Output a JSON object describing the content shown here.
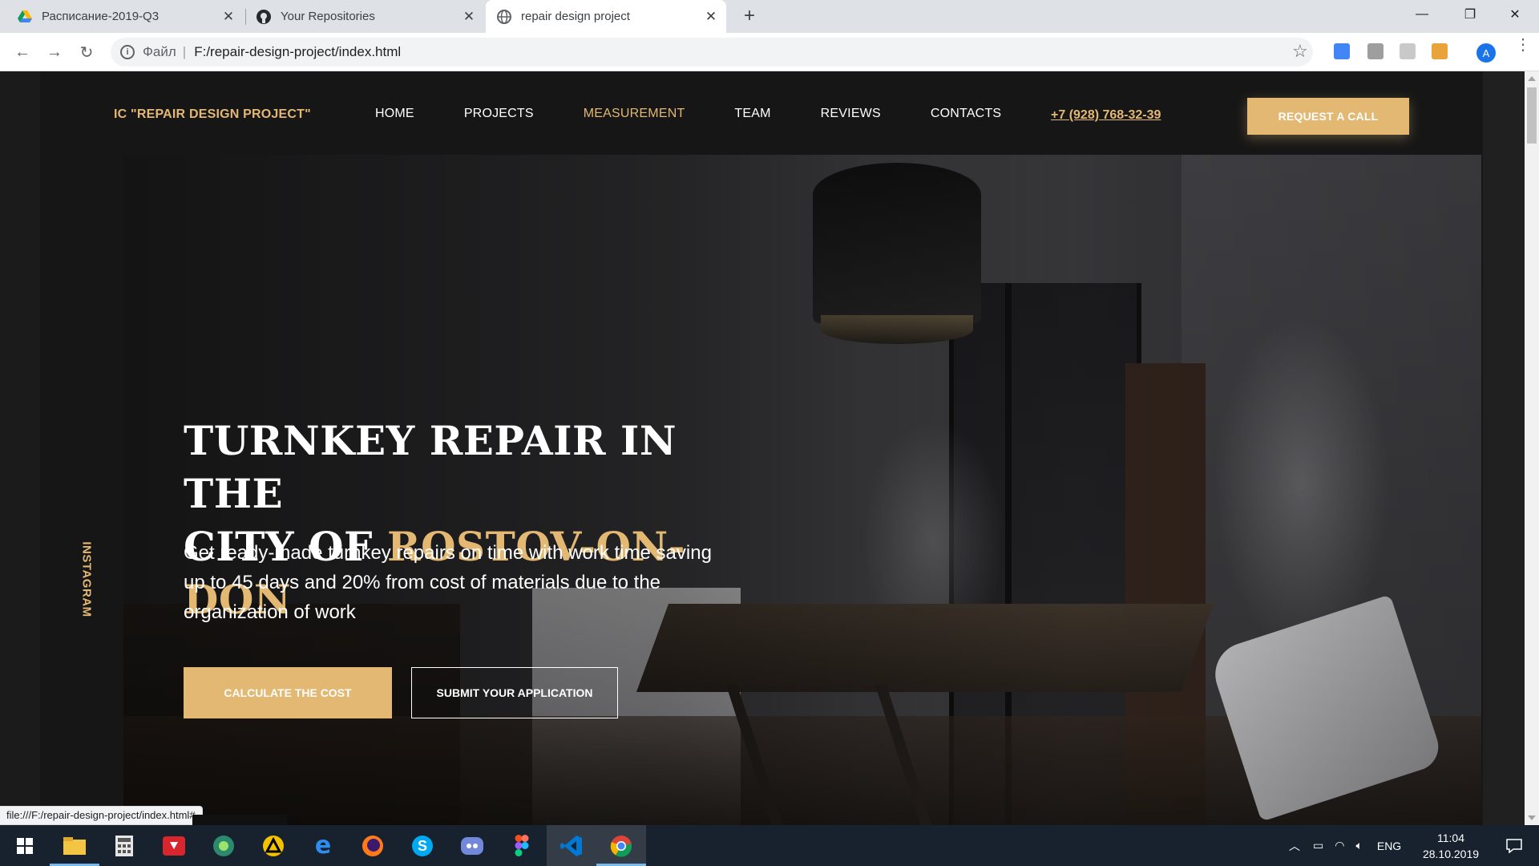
{
  "browser": {
    "tabs": [
      {
        "title": "Расписание-2019-Q3",
        "icon": "google-drive-icon",
        "active": false
      },
      {
        "title": "Your Repositories",
        "icon": "github-icon",
        "active": false
      },
      {
        "title": "repair design project",
        "icon": "globe-icon",
        "active": true
      }
    ],
    "address": {
      "scheme_label": "Файл",
      "url": "F:/repair-design-project/index.html"
    },
    "profile_initial": "A",
    "status_url": "file:///F:/repair-design-project/index.html#"
  },
  "site": {
    "brand": "IC \"REPAIR DESIGN PROJECT\"",
    "nav": [
      {
        "label": "HOME",
        "active": false
      },
      {
        "label": "PROJECTS",
        "active": false
      },
      {
        "label": "MEASUREMENT",
        "active": true
      },
      {
        "label": "TEAM",
        "active": false
      },
      {
        "label": "REVIEWS",
        "active": false
      },
      {
        "label": "CONTACTS",
        "active": false
      }
    ],
    "phone": "+7 (928) 768-32-39",
    "request_button": "REQUEST A CALL",
    "social_label": "INSTAGRAM",
    "hero": {
      "title_line1": "TURNKEY REPAIR IN THE",
      "title_line2_prefix": "CITY OF ",
      "title_line2_accent": "ROSTOV-ON-DON",
      "subtitle": "Get ready-made turnkey repairs on time with work time saving up to 45 days and 20% from cost of materials due to the organization of work",
      "primary_button": "CALCULATE THE COST",
      "secondary_button": "SUBMIT YOUR APPLICATION"
    },
    "colors": {
      "accent": "#e3b873",
      "background": "#161616"
    }
  },
  "taskbar": {
    "apps": [
      "windows-start-icon",
      "file-explorer-icon",
      "calculator-icon",
      "download-master-icon",
      "gps-icon",
      "archicad-icon",
      "edge-icon",
      "firefox-icon",
      "skype-icon",
      "discord-icon",
      "figma-icon",
      "vscode-icon",
      "chrome-icon"
    ],
    "language": "ENG",
    "time": "11:04",
    "date": "28.10.2019"
  }
}
